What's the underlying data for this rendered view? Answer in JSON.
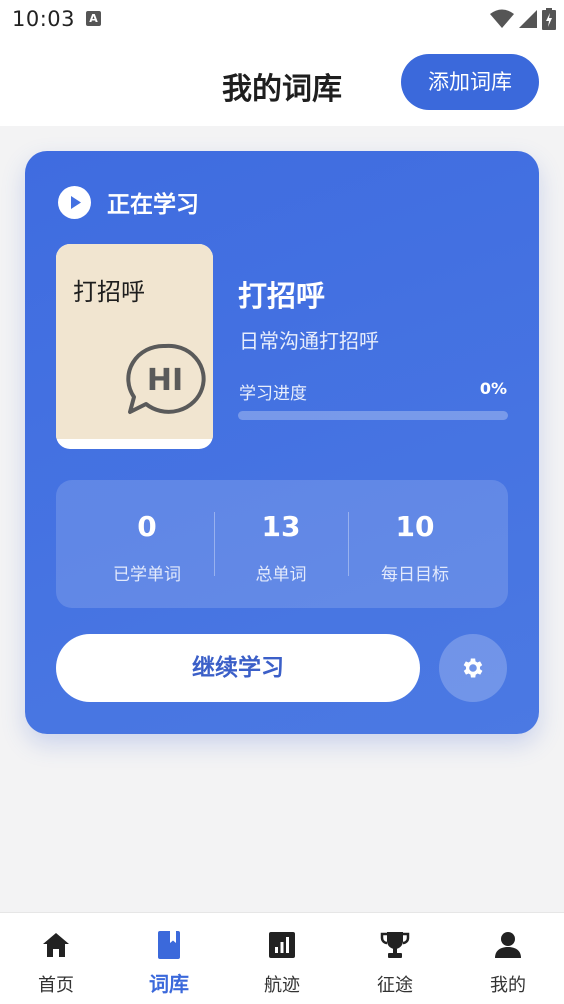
{
  "status_bar": {
    "time": "10:03",
    "notification_letter": "A"
  },
  "header": {
    "title": "我的词库",
    "add_button": "添加词库"
  },
  "card": {
    "section_label": "正在学习",
    "book": {
      "cover_title": "打招呼",
      "cover_icon_text": "HI",
      "title": "打招呼",
      "description": "日常沟通打招呼"
    },
    "progress": {
      "label": "学习进度",
      "value_text": "0%",
      "fraction": 0
    },
    "stats": [
      {
        "value": "0",
        "label": "已学单词"
      },
      {
        "value": "13",
        "label": "总单词"
      },
      {
        "value": "10",
        "label": "每日目标"
      }
    ],
    "continue_button": "继续学习"
  },
  "bottom_nav": [
    {
      "label": "首页",
      "icon": "home-icon",
      "active": false
    },
    {
      "label": "词库",
      "icon": "book-icon",
      "active": true
    },
    {
      "label": "航迹",
      "icon": "stats-icon",
      "active": false
    },
    {
      "label": "征途",
      "icon": "trophy-icon",
      "active": false
    },
    {
      "label": "我的",
      "icon": "person-icon",
      "active": false
    }
  ],
  "colors": {
    "accent": "#3b69db",
    "card_bg": "#4471e1",
    "book_cover": "#f1e5d0"
  }
}
